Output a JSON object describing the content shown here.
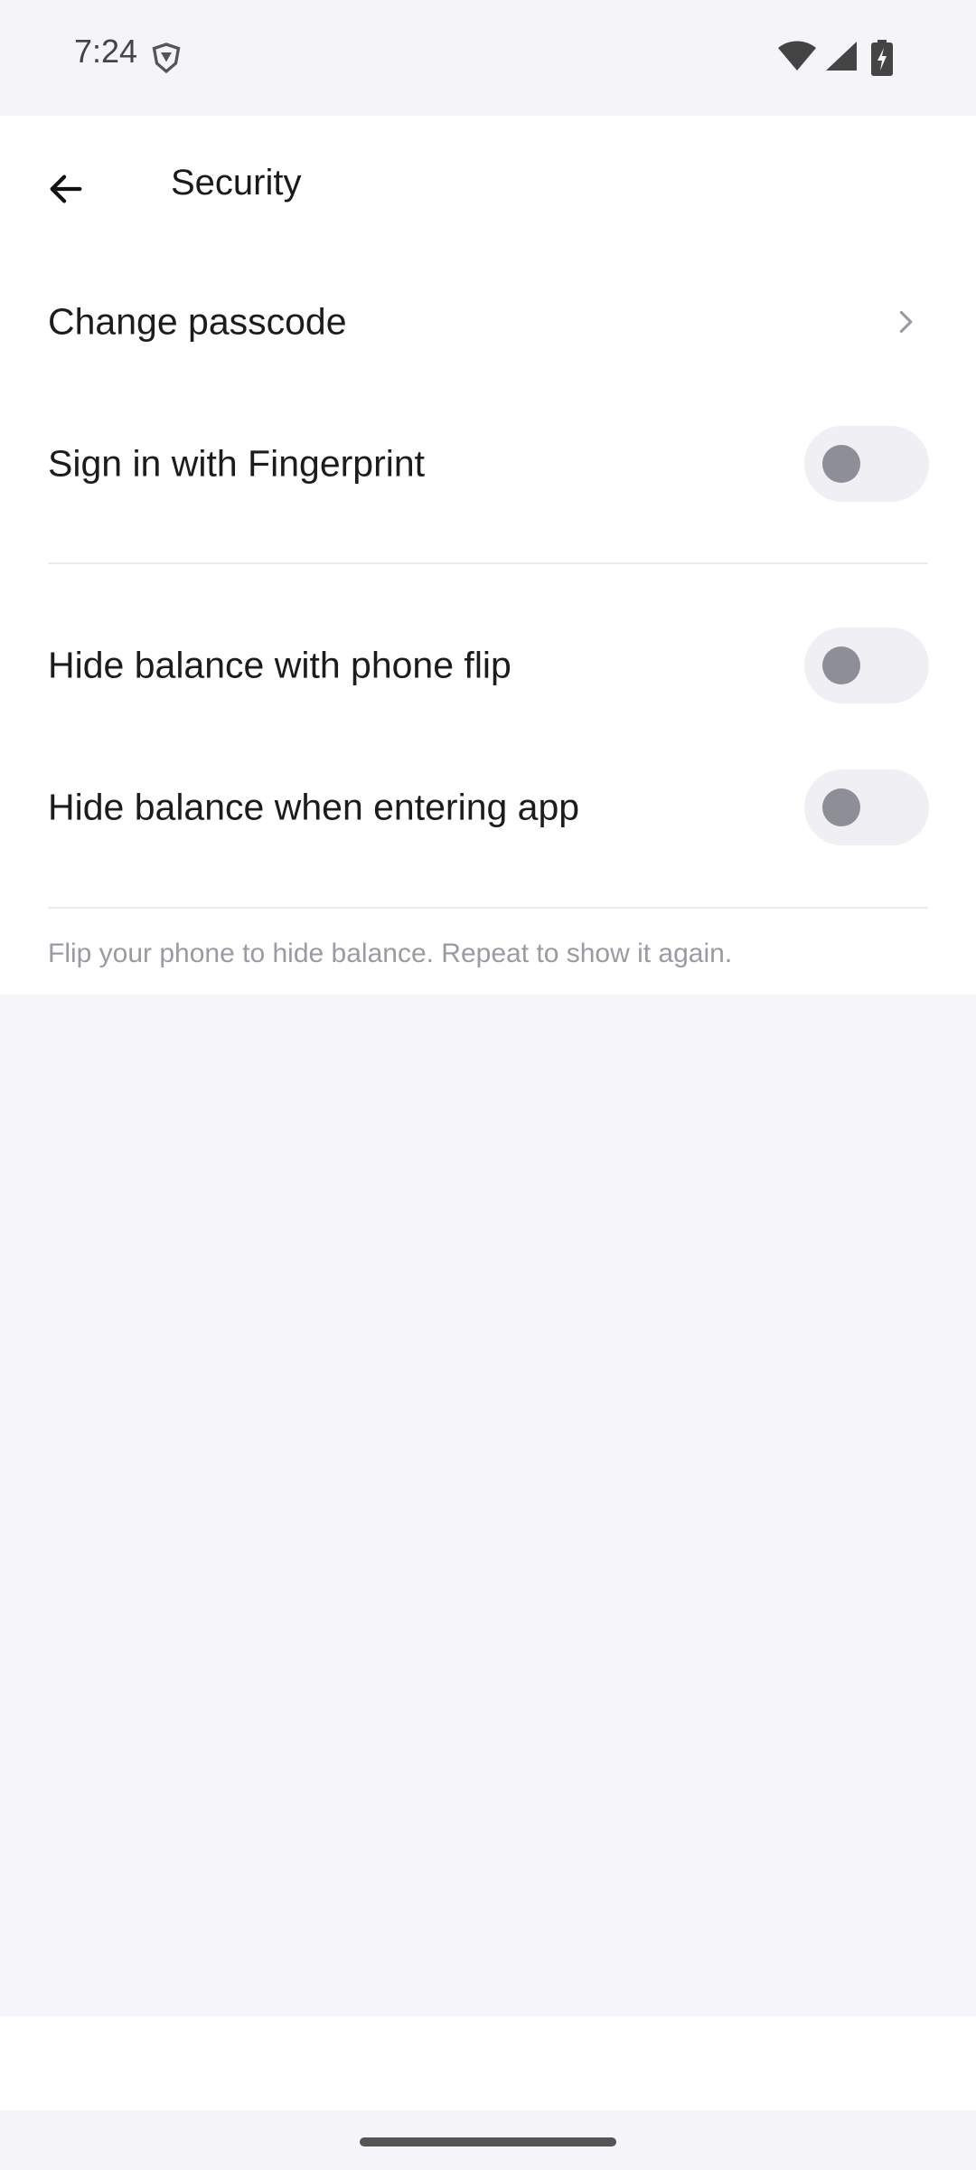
{
  "status_bar": {
    "time": "7:24",
    "icons": [
      "shield-icon",
      "wifi-icon",
      "cell-signal-icon",
      "battery-charging-icon"
    ]
  },
  "app_bar": {
    "title": "Security",
    "back_icon": "arrow-back-icon"
  },
  "settings": [
    {
      "label": "Change passcode",
      "control": "chevron"
    },
    {
      "label": "Sign in with Fingerprint",
      "control": "toggle",
      "enabled": false
    },
    {
      "label": "Hide balance with phone flip",
      "control": "toggle",
      "enabled": false
    },
    {
      "label": "Hide balance when entering app",
      "control": "toggle",
      "enabled": false
    }
  ],
  "footnote": "Flip your phone to hide balance. Repeat to show it again.",
  "colors": {
    "background": "#f5f5fa",
    "surface": "#ffffff",
    "toggle_track": "#efeff4",
    "toggle_knob": "#8e8e96",
    "text_primary": "#1c1c1e",
    "text_secondary": "#9a9aa2"
  }
}
